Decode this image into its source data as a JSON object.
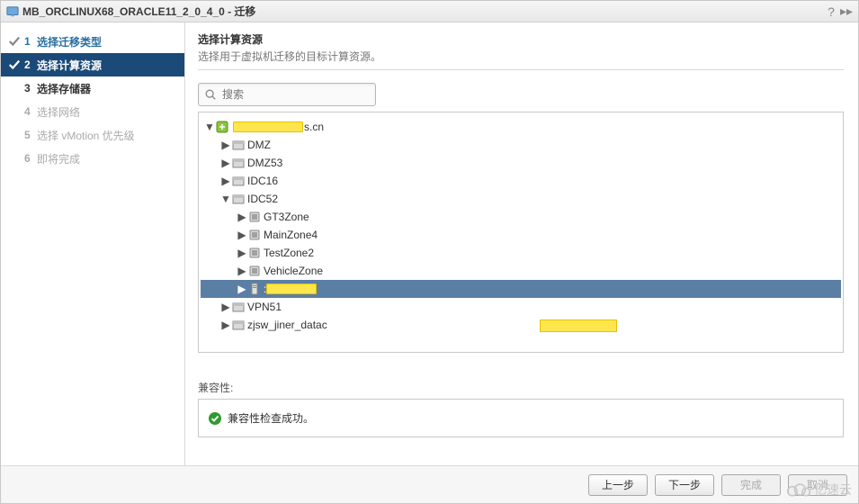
{
  "title": "MB_ORCLINUX68_ORACLE11_2_0_4_0 - 迁移",
  "steps": [
    {
      "num": "1",
      "label": "选择迁移类型",
      "state": "done"
    },
    {
      "num": "2",
      "label": "选择计算资源",
      "state": "current"
    },
    {
      "num": "3",
      "label": "选择存储器",
      "state": "next"
    },
    {
      "num": "4",
      "label": "选择网络",
      "state": "disabled"
    },
    {
      "num": "5",
      "label": "选择 vMotion 优先级",
      "state": "disabled"
    },
    {
      "num": "6",
      "label": "即将完成",
      "state": "disabled"
    }
  ],
  "mainTitle": "选择计算资源",
  "mainSubtitle": "选择用于虚拟机迁移的目标计算资源。",
  "search": {
    "placeholder": "搜索"
  },
  "tree": {
    "root_suffix": "s.cn",
    "nodes": [
      {
        "depth": 1,
        "type": "dc",
        "label": "DMZ",
        "expand": "▶"
      },
      {
        "depth": 1,
        "type": "dc",
        "label": "DMZ53",
        "expand": "▶"
      },
      {
        "depth": 1,
        "type": "dc",
        "label": "IDC16",
        "expand": "▶"
      },
      {
        "depth": 1,
        "type": "dc",
        "label": "IDC52",
        "expand": "▼"
      },
      {
        "depth": 2,
        "type": "rp",
        "label": "GT3Zone",
        "expand": "▶"
      },
      {
        "depth": 2,
        "type": "rp",
        "label": "MainZone4",
        "expand": "▶"
      },
      {
        "depth": 2,
        "type": "rp",
        "label": "TestZone2",
        "expand": "▶"
      },
      {
        "depth": 2,
        "type": "rp",
        "label": "VehicleZone",
        "expand": "▶"
      },
      {
        "depth": 2,
        "type": "host",
        "label": "",
        "expand": "▶",
        "selected": true,
        "redacted": 56
      },
      {
        "depth": 1,
        "type": "dc",
        "label": "VPN51",
        "expand": "▶"
      },
      {
        "depth": 1,
        "type": "dc",
        "label": "zjsw_jiner_datac",
        "expand": "▶"
      }
    ]
  },
  "compatLabel": "兼容性:",
  "compatMessage": "兼容性检查成功。",
  "buttons": {
    "back": "上一步",
    "next": "下一步",
    "finish": "完成",
    "cancel": "取消"
  },
  "watermark": "亿速云"
}
